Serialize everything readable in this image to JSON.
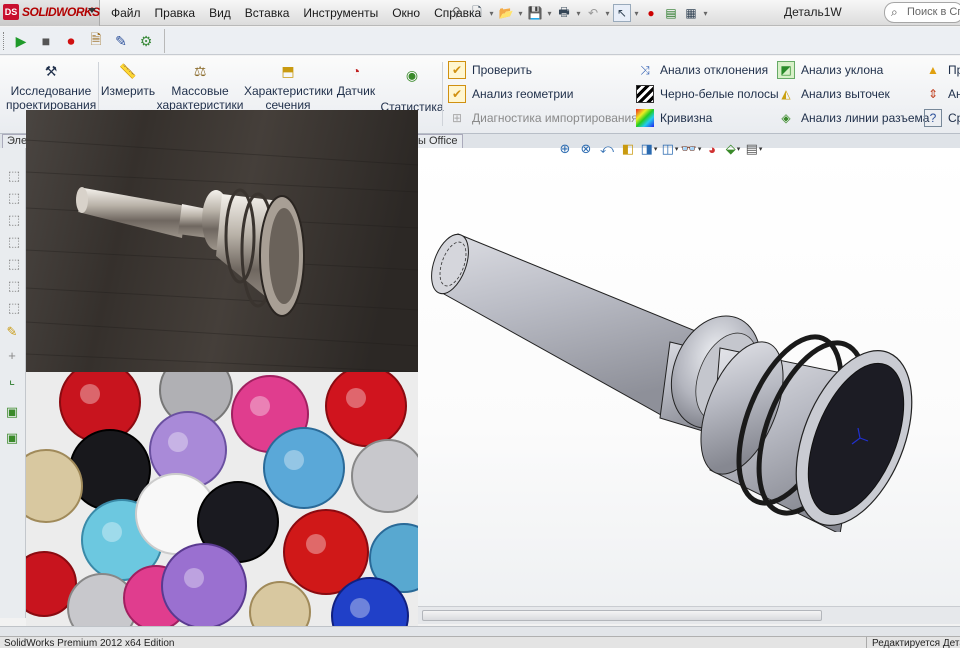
{
  "app": {
    "logo_text": "SOLIDWORKS",
    "logo_mark": "DS",
    "document_title": "Деталь1W"
  },
  "menu": [
    "Файл",
    "Правка",
    "Вид",
    "Вставка",
    "Инструменты",
    "Окно",
    "Справка"
  ],
  "search": {
    "placeholder": "Поиск в Спр"
  },
  "ribbon": {
    "study": "Исследование проектирования",
    "measure": "Измерить",
    "mass": "Массовые характеристики",
    "section": "Характеристики сечения",
    "sensor": "Датчик",
    "stats": "Статистика",
    "check": "Проверить",
    "geometry": "Анализ геометрии",
    "import_diag": "Диагностика импортирования",
    "deviation": "Анализ отклонения",
    "zebra": "Черно-белые полосы",
    "curvature": "Кривизна",
    "draft": "Анализ уклона",
    "undercut": "Анализ выточек",
    "parting": "Анализ линии разъема",
    "trunc1": "Пр",
    "trunc2": "Ан",
    "trunc3": "Ср"
  },
  "tabs": {
    "elements": "Эле",
    "office": "ты Office"
  },
  "status": {
    "left": "SolidWorks Premium 2012 x64 Edition",
    "right": "Редактируется Детал"
  },
  "colors": {
    "accent": "#c8102e",
    "part_fill": "#c9cbd2",
    "face_dark": "#1c1c24"
  }
}
